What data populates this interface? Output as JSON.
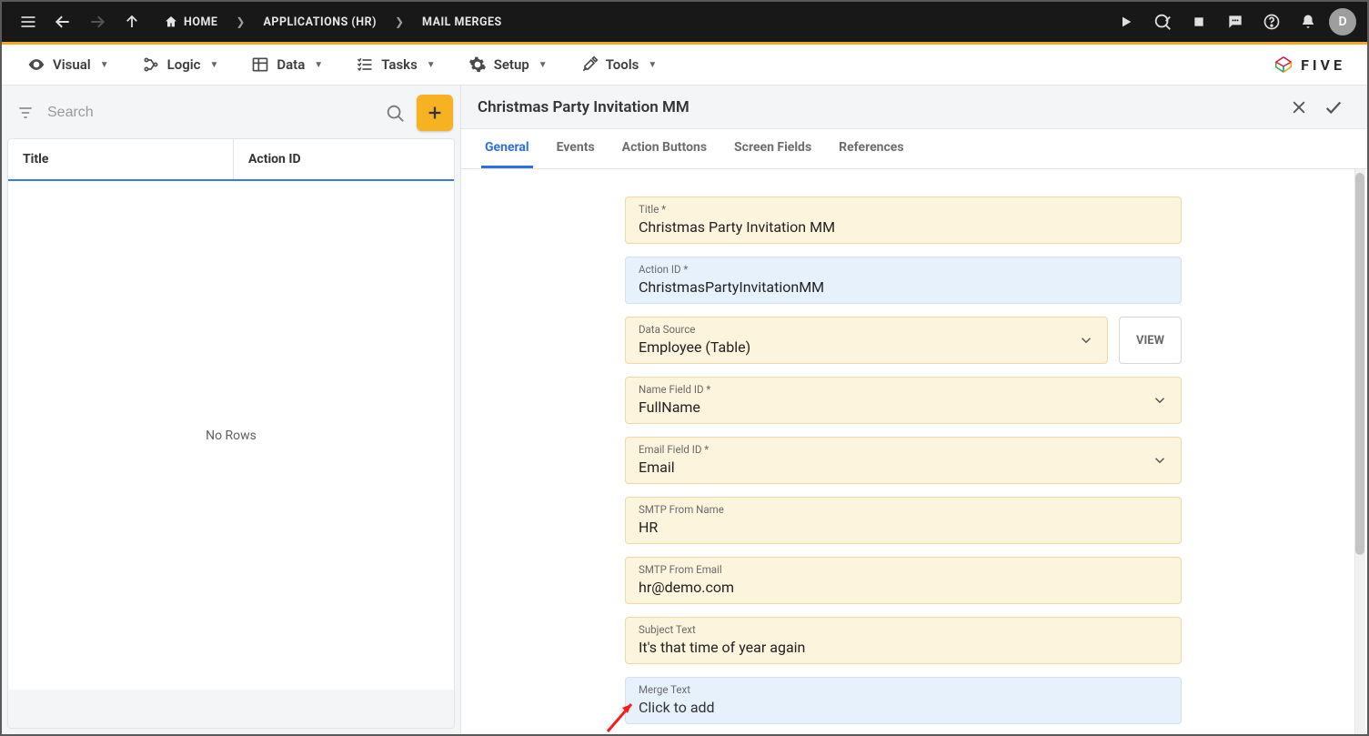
{
  "topbar": {
    "breadcrumbs": [
      {
        "label": "HOME"
      },
      {
        "label": "APPLICATIONS (HR)"
      },
      {
        "label": "MAIL MERGES"
      }
    ],
    "avatar_initial": "D"
  },
  "menubar": {
    "items": [
      {
        "label": "Visual"
      },
      {
        "label": "Logic"
      },
      {
        "label": "Data"
      },
      {
        "label": "Tasks"
      },
      {
        "label": "Setup"
      },
      {
        "label": "Tools"
      }
    ],
    "logo_text": "FIVE"
  },
  "left": {
    "search_placeholder": "Search",
    "columns": {
      "title": "Title",
      "action_id": "Action ID"
    },
    "empty_text": "No Rows"
  },
  "detail": {
    "title": "Christmas Party Invitation MM",
    "tabs": [
      {
        "label": "General",
        "active": true
      },
      {
        "label": "Events"
      },
      {
        "label": "Action Buttons"
      },
      {
        "label": "Screen Fields"
      },
      {
        "label": "References"
      }
    ],
    "view_button": "VIEW",
    "fields": {
      "title": {
        "label": "Title *",
        "value": "Christmas Party Invitation MM"
      },
      "action_id": {
        "label": "Action ID *",
        "value": "ChristmasPartyInvitationMM"
      },
      "data_source": {
        "label": "Data Source",
        "value": "Employee (Table)"
      },
      "name_field": {
        "label": "Name Field ID *",
        "value": "FullName"
      },
      "email_field": {
        "label": "Email Field ID *",
        "value": "Email"
      },
      "smtp_name": {
        "label": "SMTP From Name",
        "value": "HR"
      },
      "smtp_email": {
        "label": "SMTP From Email",
        "value": "hr@demo.com"
      },
      "subject": {
        "label": "Subject Text",
        "value": "It's that time of year again"
      },
      "merge_text": {
        "label": "Merge Text",
        "value": "Click to add"
      }
    }
  }
}
